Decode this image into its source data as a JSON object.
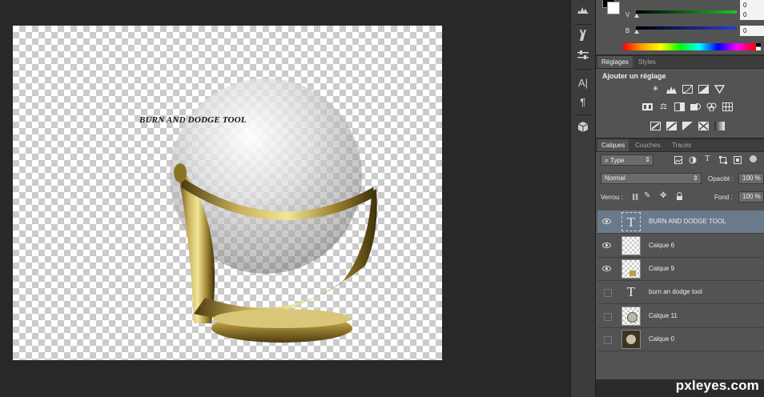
{
  "canvas": {
    "title_text": "BURN AND DODGE TOOL"
  },
  "toolbar": {
    "tools": [
      "histogram-icon",
      "brush-presets-icon",
      "adjust-sliders-icon",
      "character-icon",
      "paragraph-icon",
      "3d-cube-icon"
    ],
    "character_glyph": "A|",
    "paragraph_glyph": "¶"
  },
  "color_panel": {
    "channels": [
      {
        "label": "V",
        "value": "0",
        "color": "#22c22a"
      },
      {
        "label": "B",
        "value": "0",
        "color": "#2a3bd8"
      }
    ],
    "top_value": "0"
  },
  "adjustments_panel": {
    "tabs": [
      "Réglages",
      "Styles"
    ],
    "active_tab": "Réglages",
    "heading": "Ajouter un réglage",
    "icon_rows": [
      [
        "brightness-icon",
        "levels-icon",
        "curves-icon",
        "exposure-icon",
        "vibrance-icon"
      ],
      [
        "hue-saturation-icon",
        "color-balance-icon",
        "black-white-icon",
        "photo-filter-icon",
        "channel-mixer-icon",
        "color-lookup-icon"
      ],
      [
        "invert-icon",
        "posterize-icon",
        "threshold-icon",
        "selective-color-icon",
        "gradient-map-icon"
      ]
    ]
  },
  "layers_panel": {
    "tabs": [
      "Calques",
      "Couches",
      "Tracés"
    ],
    "active_tab": "Calques",
    "filter_label": "Type",
    "blend_mode": "Normal",
    "opacity_label": "Opacité :",
    "opacity_value": "100 %",
    "lock_label": "Verrou :",
    "fill_label": "Fond :",
    "fill_value": "100 %",
    "layers": [
      {
        "name": "BURN AND DODGE TOOL",
        "kind": "text",
        "visible": true,
        "selected": true
      },
      {
        "name": "Calque 6",
        "kind": "pixel",
        "visible": true,
        "selected": false
      },
      {
        "name": "Calque 9",
        "kind": "pixel",
        "visible": true,
        "selected": false
      },
      {
        "name": "burn an dodge tool",
        "kind": "text",
        "visible": false,
        "selected": false
      },
      {
        "name": "Calque 11",
        "kind": "pixel",
        "visible": false,
        "selected": false
      },
      {
        "name": "Calque 0",
        "kind": "pixel",
        "visible": false,
        "selected": false
      }
    ],
    "text_glyph": "T"
  },
  "watermark": "pxleyes.com"
}
